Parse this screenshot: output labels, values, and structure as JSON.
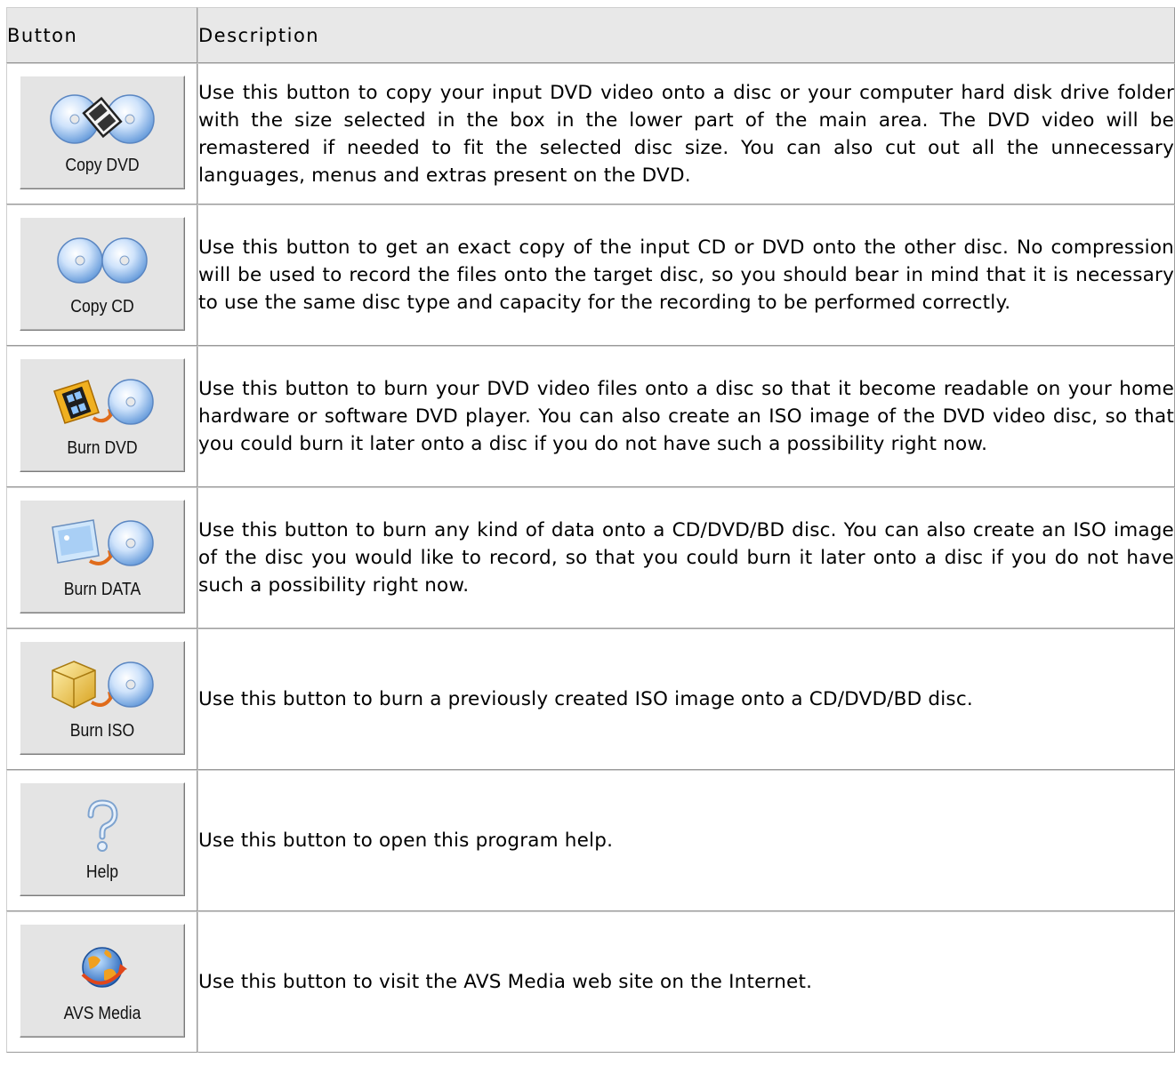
{
  "table": {
    "headers": {
      "button": "Button",
      "description": "Description"
    },
    "rows": [
      {
        "label": "Copy DVD",
        "icon": "copy-dvd-icon",
        "description": "Use this button to copy your input DVD video onto a disc or your computer hard disk drive folder with the size selected in the box in the lower part of the main area. The DVD video will be remastered if needed to fit the selected disc size. You can also cut out all the unnecessary languages, menus and extras present on the DVD."
      },
      {
        "label": "Copy CD",
        "icon": "copy-cd-icon",
        "description": "Use this button to get an exact copy of the input CD or DVD onto the other disc. No compression will be used to record the files onto the target disc, so you should bear in mind that it is necessary to use the same disc type and capacity for the recording to be performed correctly."
      },
      {
        "label": "Burn DVD",
        "icon": "burn-dvd-icon",
        "description": "Use this button to burn your DVD video files onto a disc so that it become readable on your home hardware or software DVD player. You can also create an ISO image of the DVD video disc, so that you could burn it later onto a disc if you do not have such a possibility right now."
      },
      {
        "label": "Burn DATA",
        "icon": "burn-data-icon",
        "description": "Use this button to burn any kind of data onto a CD/DVD/BD disc. You can also create an ISO image of the disc you would like to record, so that you could burn it later onto a disc if you do not have such a possibility right now."
      },
      {
        "label": "Burn ISO",
        "icon": "burn-iso-icon",
        "description": "Use this button to burn a previously created ISO image onto a CD/DVD/BD disc."
      },
      {
        "label": "Help",
        "icon": "help-icon",
        "description": "Use this button to open this program help."
      },
      {
        "label": "AVS Media",
        "icon": "avs-media-icon",
        "description": "Use this button to visit the AVS Media web site on the Internet."
      }
    ]
  }
}
